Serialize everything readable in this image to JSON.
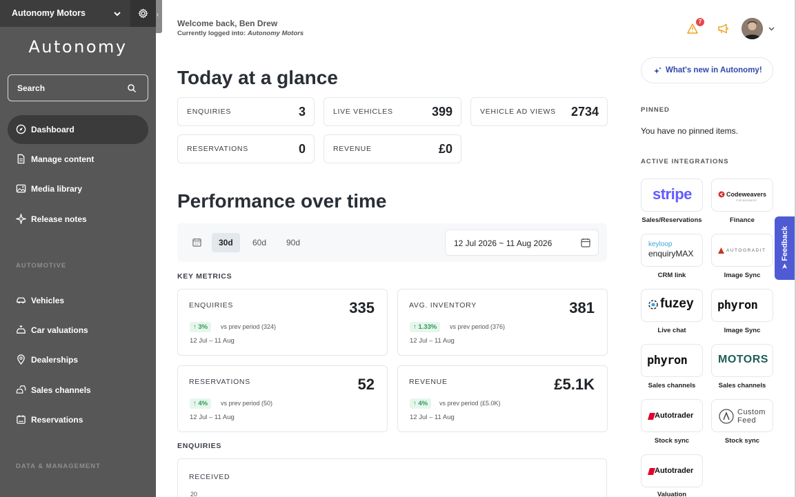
{
  "sidebar": {
    "org_name": "Autonomy Motors",
    "logo_text": "Autonomy",
    "search_label": "Search",
    "nav_main": [
      {
        "label": "Dashboard",
        "icon": "compass-icon",
        "active": true
      },
      {
        "label": "Manage content",
        "icon": "document-icon",
        "active": false
      },
      {
        "label": "Media library",
        "icon": "image-icon",
        "active": false
      },
      {
        "label": "Release notes",
        "icon": "sparkle-icon",
        "active": false
      }
    ],
    "section_automotive": "AUTOMOTIVE",
    "nav_automotive": [
      {
        "label": "Vehicles",
        "icon": "car-icon"
      },
      {
        "label": "Car valuations",
        "icon": "car-valuation-icon"
      },
      {
        "label": "Dealerships",
        "icon": "location-pin-icon"
      },
      {
        "label": "Sales channels",
        "icon": "channels-icon"
      },
      {
        "label": "Reservations",
        "icon": "reservation-icon"
      }
    ],
    "section_data": "DATA & MANAGEMENT"
  },
  "header": {
    "welcome": "Welcome back, Ben Drew",
    "logged_in_prefix": "Currently logged into: ",
    "logged_in_org": "Autonomy Motors",
    "alert_count": "7"
  },
  "glance": {
    "title": "Today at a glance",
    "stats": [
      {
        "label": "ENQUIRIES",
        "value": "3"
      },
      {
        "label": "LIVE VEHICLES",
        "value": "399"
      },
      {
        "label": "VEHICLE AD VIEWS",
        "value": "2734"
      },
      {
        "label": "RESERVATIONS",
        "value": "0"
      },
      {
        "label": "REVENUE",
        "value": "£0"
      }
    ]
  },
  "performance": {
    "title": "Performance over time",
    "ranges": [
      "30d",
      "60d",
      "90d"
    ],
    "active_range": "30d",
    "date_range": "12 Jul 2026 ~ 11 Aug 2026",
    "key_metrics_label": "KEY METRICS",
    "metrics": [
      {
        "label": "ENQUIRIES",
        "value": "335",
        "change": "3%",
        "prev": "vs prev period (324)",
        "dates": "12 Jul – 11 Aug"
      },
      {
        "label": "AVG. INVENTORY",
        "value": "381",
        "change": "1.33%",
        "prev": "vs prev period (376)",
        "dates": "12 Jul – 11 Aug"
      },
      {
        "label": "RESERVATIONS",
        "value": "52",
        "change": "4%",
        "prev": "vs prev period (50)",
        "dates": "12 Jul – 11 Aug"
      },
      {
        "label": "REVENUE",
        "value": "£5.1K",
        "change": "4%",
        "prev": "vs prev period (£5.0K)",
        "dates": "12 Jul – 11 Aug"
      }
    ],
    "enquiries_label": "ENQUIRIES",
    "received_label": "RECEIVED",
    "received_axis_top": "20"
  },
  "right_panel": {
    "whats_new": "What's new in Autonomy!",
    "pinned_label": "PINNED",
    "no_pinned": "You have no pinned items.",
    "integrations_label": "ACTIVE INTEGRATIONS",
    "integrations": [
      {
        "logo": "stripe",
        "caption": "Sales/Reservations"
      },
      {
        "logo": "Codeweavers",
        "logo_sub": "FOR BUSINESS",
        "caption": "Finance"
      },
      {
        "logo": "keyloop",
        "logo_sub": "enquiryMAX",
        "caption": "CRM link"
      },
      {
        "logo": "AUTOGRADIT",
        "caption": "Image Sync"
      },
      {
        "logo": "fuzey",
        "caption": "Live chat"
      },
      {
        "logo": "phyron",
        "caption": "Image Sync"
      },
      {
        "logo": "phyron",
        "caption": "Sales channels"
      },
      {
        "logo": "MOTORS",
        "caption": "Sales channels"
      },
      {
        "logo": "Autotrader",
        "caption": "Stock sync"
      },
      {
        "logo": "Custom",
        "logo_sub": "Feed",
        "caption": "Stock sync"
      },
      {
        "logo": "Autotrader",
        "caption": "Valuation"
      }
    ],
    "feedback": "Feedback"
  },
  "colors": {
    "sidebar_bg": "#575757",
    "accent_blue": "#4f5bd5",
    "success_green": "#2e9a57",
    "alert_red": "#e5484d",
    "stripe_purple": "#635bff",
    "autotrader_red": "#e4002b"
  }
}
